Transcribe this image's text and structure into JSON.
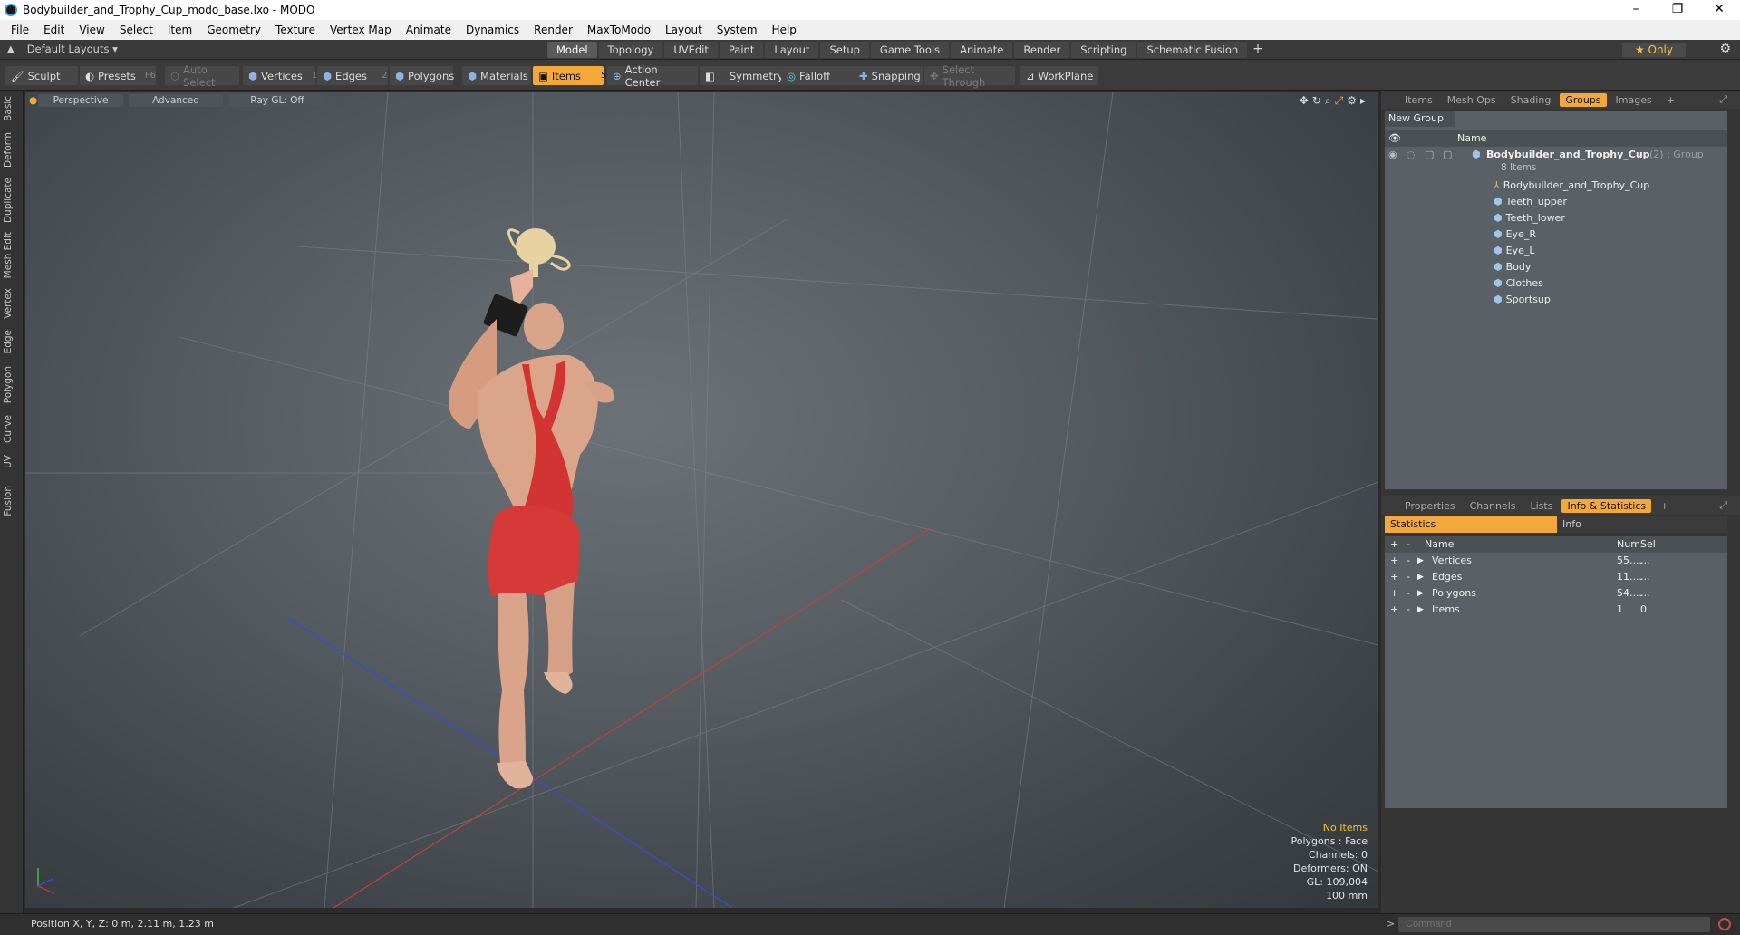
{
  "window": {
    "title": "Bodybuilder_and_Trophy_Cup_modo_base.lxo - MODO"
  },
  "menu": [
    "File",
    "Edit",
    "View",
    "Select",
    "Item",
    "Geometry",
    "Texture",
    "Vertex Map",
    "Animate",
    "Dynamics",
    "Render",
    "MaxToModo",
    "Layout",
    "System",
    "Help"
  ],
  "layout": {
    "preset": "Default Layouts ▾",
    "tabs": [
      "Model",
      "Topology",
      "UVEdit",
      "Paint",
      "Layout",
      "Setup",
      "Game Tools",
      "Animate",
      "Render",
      "Scripting",
      "Schematic Fusion"
    ],
    "active_tab": "Model",
    "only_label": "★  Only"
  },
  "toolbar": {
    "sculpt": "Sculpt",
    "presets": "Presets",
    "presets_key": "F6",
    "auto_select": "Auto Select",
    "vertices": "Vertices",
    "vertices_count": "1",
    "edges": "Edges",
    "edges_count": "2",
    "polygons": "Polygons",
    "materials": "Materials",
    "items": "Items",
    "items_count": "5",
    "action_center": "Action Center",
    "symmetry": "Symmetry",
    "falloff": "Falloff",
    "snapping": "Snapping",
    "select_through": "Select Through",
    "workplane": "WorkPlane"
  },
  "left_tabs": [
    "Basic",
    "Deform",
    "Duplicate",
    "Mesh Edit",
    "Vertex",
    "Edge",
    "Polygon",
    "Curve",
    "UV",
    "Fusion"
  ],
  "viewport": {
    "perspective": "Perspective",
    "advanced": "Advanced",
    "raygl": "Ray GL: Off",
    "info": [
      "No Items",
      "Polygons : Face",
      "Channels: 0",
      "Deformers: ON",
      "GL: 109,004",
      "100 mm"
    ]
  },
  "groups_panel": {
    "tabs": [
      "Items",
      "Mesh Ops",
      "Shading",
      "Groups",
      "Images"
    ],
    "active_tab": "Groups",
    "new_group": "New Group",
    "col_name": "Name",
    "group_name": "Bodybuilder_and_Trophy_Cup",
    "group_suffix": "(2) : Group",
    "group_count": "8 Items",
    "items": [
      "Bodybuilder_and_Trophy_Cup",
      "Teeth_upper",
      "Teeth_lower",
      "Eye_R",
      "Eye_L",
      "Body",
      "Clothes",
      "Sportsup"
    ]
  },
  "info_panel": {
    "tabs": [
      "Properties",
      "Channels",
      "Lists",
      "Info & Statistics"
    ],
    "active_tab": "Info & Statistics",
    "sub_tabs": [
      "Statistics",
      "Info"
    ],
    "headers": {
      "name": "Name",
      "num": "Num",
      "sel": "Sel"
    },
    "rows": [
      {
        "name": "Vertices",
        "num": "55....",
        "sel": "..."
      },
      {
        "name": "Edges",
        "num": "11....",
        "sel": "..."
      },
      {
        "name": "Polygons",
        "num": "54....",
        "sel": "..."
      },
      {
        "name": "Items",
        "num": "1",
        "sel": "0"
      }
    ]
  },
  "status": {
    "position": "Position X, Y, Z:   0 m, 2.11 m, 1.23 m",
    "command_placeholder": "Command"
  }
}
